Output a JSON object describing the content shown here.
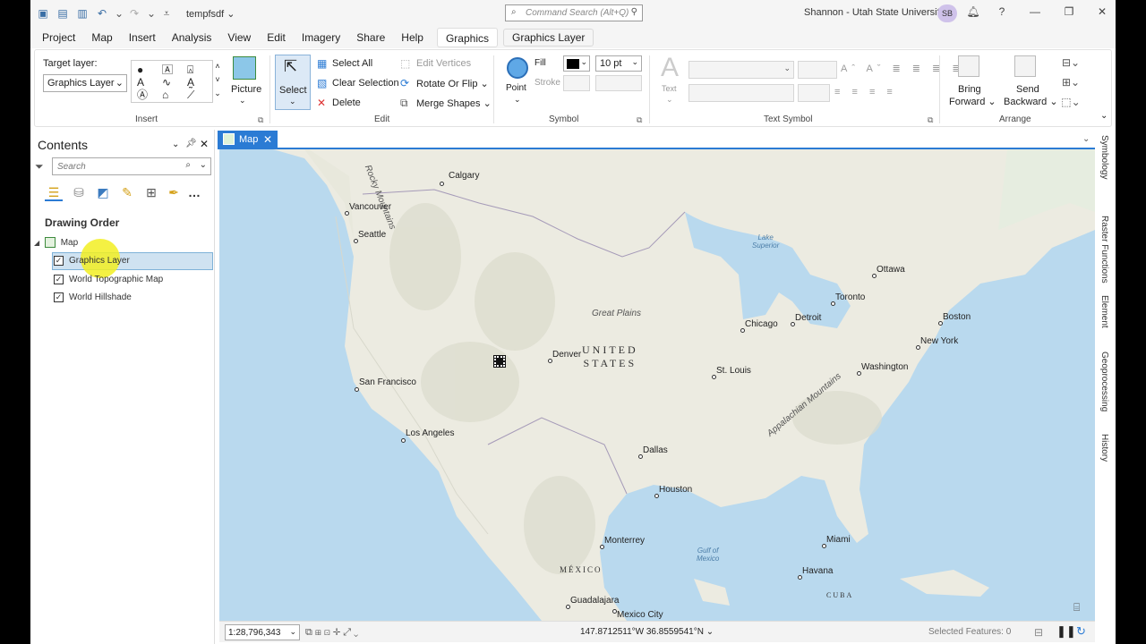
{
  "title_bar": {
    "project_name": "tempfsdf",
    "command_search_placeholder": "Command Search (Alt+Q)",
    "user_name": "Shannon - Utah State University",
    "user_initials": "SB"
  },
  "ribbon_tabs": [
    "Project",
    "Map",
    "Insert",
    "Analysis",
    "View",
    "Edit",
    "Imagery",
    "Share",
    "Help",
    "Graphics",
    "Graphics Layer"
  ],
  "active_tab": "Graphics",
  "ribbon": {
    "insert": {
      "title": "Insert",
      "target_layer_label": "Target layer:",
      "target_layer_value": "Graphics Layer",
      "picture_label": "Picture"
    },
    "edit": {
      "title": "Edit",
      "select_label": "Select",
      "select_all": "Select All",
      "clear_selection": "Clear Selection",
      "delete": "Delete",
      "edit_vertices": "Edit Vertices",
      "rotate_or_flip": "Rotate Or Flip",
      "merge_shapes": "Merge Shapes"
    },
    "symbol": {
      "title": "Symbol",
      "point_label": "Point",
      "fill_label": "Fill",
      "stroke_label": "Stroke",
      "size_value": "10 pt"
    },
    "text_symbol": {
      "title": "Text Symbol",
      "text_label": "Text"
    },
    "arrange": {
      "title": "Arrange",
      "bring_forward_1": "Bring",
      "bring_forward_2": "Forward",
      "send_backward_1": "Send",
      "send_backward_2": "Backward"
    }
  },
  "contents": {
    "title": "Contents",
    "search_placeholder": "Search",
    "drawing_order": "Drawing Order",
    "map_node": "Map",
    "layers": [
      {
        "name": "Graphics Layer",
        "checked": true,
        "selected": true
      },
      {
        "name": "World Topographic Map",
        "checked": true,
        "selected": false
      },
      {
        "name": "World Hillshade",
        "checked": true,
        "selected": false
      }
    ]
  },
  "map_view": {
    "tab_label": "Map",
    "cities": [
      {
        "name": "Calgary"
      },
      {
        "name": "Vancouver"
      },
      {
        "name": "Seattle"
      },
      {
        "name": "San Francisco"
      },
      {
        "name": "Los Angeles"
      },
      {
        "name": "Denver"
      },
      {
        "name": "Dallas"
      },
      {
        "name": "Houston"
      },
      {
        "name": "Monterrey"
      },
      {
        "name": "Guadalajara"
      },
      {
        "name": "Mexico City"
      },
      {
        "name": "St. Louis"
      },
      {
        "name": "Chicago"
      },
      {
        "name": "Detroit"
      },
      {
        "name": "Toronto"
      },
      {
        "name": "Ottawa"
      },
      {
        "name": "Boston"
      },
      {
        "name": "New York"
      },
      {
        "name": "Washington"
      },
      {
        "name": "Miami"
      },
      {
        "name": "Havana"
      }
    ],
    "labels": {
      "rocky_mountains": "Rocky Mountains",
      "great_plains": "Great Plains",
      "appalachian": "Appalachian Mountains",
      "lake_superior_1": "Lake",
      "lake_superior_2": "Superior",
      "gulf_1": "Gulf of",
      "gulf_2": "Mexico",
      "united": "UNITED",
      "states": "STATES",
      "mexico": "MÉXICO",
      "cuba": "CUBA"
    }
  },
  "dock_tabs": [
    "Symbology",
    "Raster Functions",
    "Element",
    "Geoprocessing",
    "History"
  ],
  "status_bar": {
    "scale": "1:28,796,343",
    "coordinates": "147.8712511°W 36.8559541°N",
    "selected_features": "Selected Features: 0"
  },
  "colors": {
    "accent": "#2b7bd4",
    "selection": "#cfe2f1",
    "land": "#ecebe1",
    "water": "#b9d9ee"
  }
}
